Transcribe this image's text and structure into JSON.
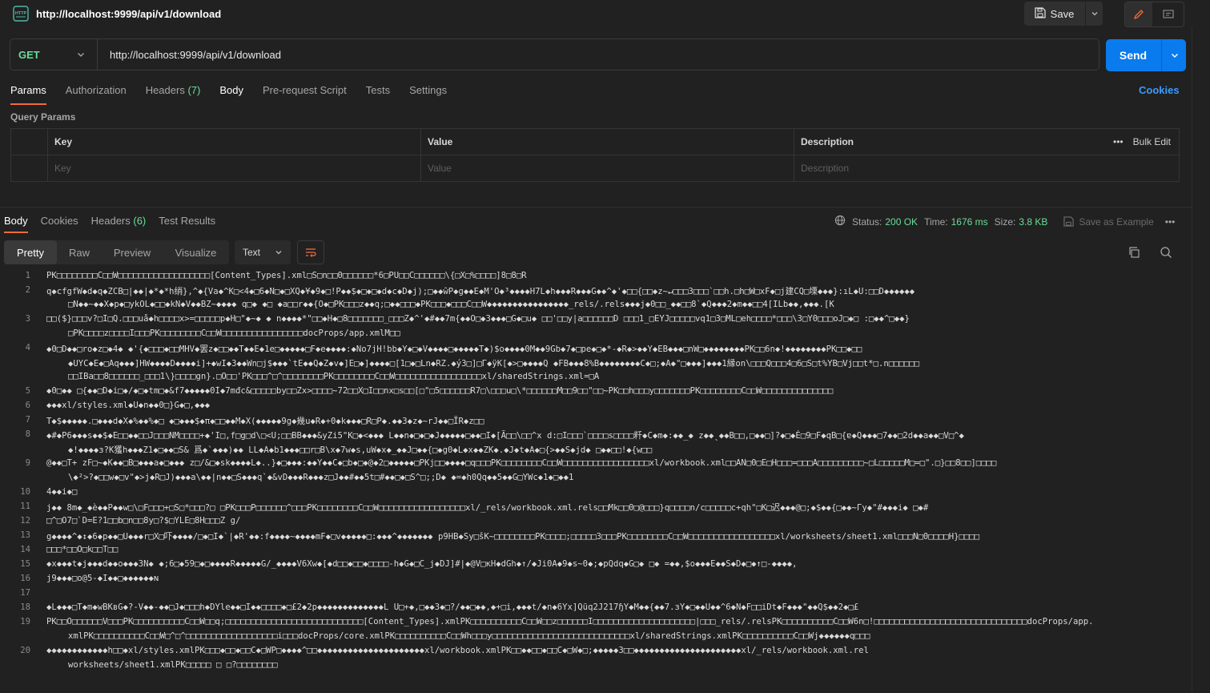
{
  "request": {
    "title": "http://localhost:9999/api/v1/download",
    "method": "GET",
    "url": "http://localhost:9999/api/v1/download",
    "save_label": "Save",
    "send_label": "Send"
  },
  "request_tabs": [
    {
      "label": "Params"
    },
    {
      "label": "Authorization"
    },
    {
      "label": "Headers",
      "count": "(7)"
    },
    {
      "label": "Body"
    },
    {
      "label": "Pre-request Script"
    },
    {
      "label": "Tests"
    },
    {
      "label": "Settings"
    }
  ],
  "cookies_label": "Cookies",
  "query_params": {
    "label": "Query Params",
    "headers": {
      "key": "Key",
      "value": "Value",
      "description": "Description",
      "bulk_edit": "Bulk Edit"
    },
    "placeholders": {
      "key": "Key",
      "value": "Value",
      "description": "Description"
    }
  },
  "response": {
    "tabs": [
      {
        "label": "Body"
      },
      {
        "label": "Cookies"
      },
      {
        "label": "Headers",
        "count": "(6)"
      },
      {
        "label": "Test Results"
      }
    ],
    "status_label": "Status:",
    "status_value": "200 OK",
    "time_label": "Time:",
    "time_value": "1676 ms",
    "size_label": "Size:",
    "size_value": "3.8 KB",
    "save_example": "Save as Example",
    "formats": [
      "Pretty",
      "Raw",
      "Preview",
      "Visualize"
    ],
    "text_format": "Text"
  },
  "colors": {
    "accent": "#f26b3a",
    "send": "#097bed",
    "link": "#3b9cff",
    "success": "#6bdd9a"
  },
  "icons": [
    "http-icon",
    "save-icon",
    "chevron-down-icon",
    "pencil-icon",
    "comment-icon",
    "globe-icon",
    "ellipsis-icon",
    "wrap-icon",
    "copy-icon",
    "search-icon"
  ],
  "code_lines": [
    {
      "n": "1",
      "parts": [
        "PK□□□□□□□□C□□W□□□□□□□□□□□□□□□□□□[Content_Types].xml□S□n□□0□□□□□□*6□PU□□C□□□□□□\\{□X□%□□□□]8□8□R"
      ]
    },
    {
      "n": "2",
      "parts": [
        "q◆cfgfW◆d◆q◆ZCB□|◆◆|◆*◆*h绡},^◆{Va◆^K□<4◆□6◆N□◆□XQ◆¥◆9◆□!P◆◆$◆□◆□◆d◆c◆D◆j);□◆◆ŵP◆g◆◆E◆M'O◆³◆◆◆◆H7L◆h◆◆◆R◆◆◆G◆◆^◆'◆□□{□□◆z~↵□□□3□□□`□□h.□h□W□xF◆□j建CQ□塛◆◆◆}:ıL◆U:□□D◆◆◆◆◆◆",
        "□N◆◆~◆◆X◆p◆□ykOL◆□□◆kN◆V◆◆BZ~◆◆◆◆ q□◆ ◆□ ◆a□□r◆◆{O◆□PK□□□z◆◆q;□◆◆□□□◆PK□□□◆□□□C□□W◆◆◆◆◆◆◆◆◆◆◆◆◆◆◆◆_rels/.rels◆◆◆j◆0□□_◆◆□□8`◆Q◆◆◆2◆m◆◆□□4[ILb◆◆,◆◆◆.[K"
      ]
    },
    {
      "n": "3",
      "parts": [
        "□□($}□□□v?□I□Q.□□□uå◆h□□□□x>=□□□□□p◆H□\"◆~◆ ◆ n◆◆◆◆*\"□□◆H◆□8□□□□□□□_□□□Z◆^'◆#◆◆7m{◆◆O□◆3◆◆◆□G◆□u◆ □□'□□y|a□□□□□□D  □□□1_□EYJ□□□□□vq1□3□ML□eh□□□□*□□□\\3□Y0□□□oJ□◆□ :□◆◆^□◆◆}",
        "□PK□□□□z□□□□I□□□PK□□□□□□□□C□□W□□□□□□□□□□□□□□□□docProps/app.xmlM□□"
      ]
    },
    {
      "n": "4",
      "parts": [
        "◆0□D◆◆□ro◆z□◆4◆ ◆'{◆□□□◆□□MHV◆罢z◆□□◆◆T◆◆E◆1e□◆◆◆◆◆□F◆e◆◆◆◆:◆No7jH!bb◆Y◆□◆V◆◆◆◆□◆◆◆◆◆T◆)$o◆◆◆◆0M◆◆9Gb◆7◆□pe◆□◆*-◆R◆>◆◆Y◆EB◆◆◆□nW□◆◆◆◆◆◆◆◆PK□□6n◆!◆◆◆◆◆◆◆◆PK□□◆□□",
        "◆UYC◆E◆□Aq◆◆◆]HW◆◆◆◆D◆◆◆◆i]+◆wI◆3◆◆Wn□j$◆◆◆`tE◆◆Q◆Z◆v◆]E□◆]◆◆◆◆□[1□◆□Ln◆RZ.◆ý3□]□Γ◆ÿK[◆>□◆◆◆◆Q  ◆FB◆◆◆8%B◆◆◆◆◆◆◆◆C◆□;◆A◆\"□◆◆◆]◆◆◆1縁on\\□□□Q□□□4□6□S□t%YB□Vj□□t*□.n□□□□□□",
        "□□IBa□□8□□□□□□_□□□1\\}□□□□gn}.□O□□'PK□□□^□^□□□□□□□□PK□□□□□□□□C□□W□□□□□□□□□□□□□□□□□xl/sharedStrings.xml=□A"
      ]
    },
    {
      "n": "5",
      "parts": [
        "◆0□◆◆ □{◆◆□D◆i□◆/◆□◆tm□◆&f7◆◆◆◆◆0Ì◆7mđc&□□□□□by□□Zx>□□□□~72□□X□I□□nx□s□□[□\"□5□□□□□□R7□\\□□□u□\\*□□□□□□M□□9□□\"□□~PK□□h□□□y□□□□□□□PK□□□□□□□□C□□W□□□□□□□□□□□□□□"
      ]
    },
    {
      "n": "6",
      "parts": [
        "◆◆◆xl/styles.xml◆U◆n◆◆0□}G◆□,◆◆◆"
      ]
    },
    {
      "n": "7",
      "parts": [
        "T◆$◆◆◆◆◆.□◆◆◆d◆X◆%◆◆%◆□ ◆□◆◆◆$◆π◆□□◆◆M◆X(◆◆◆◆◆9g◆幾u◆R◆+0◆k◆◆◆□R□P◆.◆◆3◆z◆~rJ◆◆□ÏR◆z□□"
      ]
    },
    {
      "n": "8",
      "parts": [
        "◆#◆P6◆◆◆s◆◆$◆E□□◆◆□□J□□□NM□□□□+◆'I□,f□g□d\\□<U;□□BB◆◆◆&yZi5\"K□◆<◆◆◆  L◆◆n◆□◆□◆J◆◆◆◆◆□◆◆□I◆[Ã□□\\□□^x d:□I□□□`□□□□s□□□□粁◆C◆m◆:◆◆_◆ z◆◆ˎ◆◆B□□,□◆◆□]?◆□◆Ė□9□F◆qB□{ɐ◆Q◆◆◆□7◆◆□2d◆◆a◆◆□V□^◆",
        "◆!◆◆◆◆з?K獲h◆◆◆Z1◆□◆◆□S& 爲◆`◆◆◆)◆◆ LL◆A◆b1◆◆◆□□r□B\\x◆7w◆s,uW◆x◆_◆◆J□◆◆{□◆g0◆L◆x◆◆ZK◆.◆J◆t◆A◆□{>◆◆S◆jd◆ □◆◆□□!◆{w□□"
      ]
    },
    {
      "n": "9",
      "parts": [
        "@◆◆□T+  zF□~◆K◆◆□B□◆◆◆a◆□◆◆◆ z□/&□◆sk◆◆◆◆L◆..}◆□◆◆◆:◆◆Y◆◆C◆□b◆□◆@◆2□◆◆◆◆◆□PKj□□◆◆◆◆□q□□□PK□□□□□□□□C□□W□□□□□□□□□□□□□□□□□xl/workbook.xml□□AN□0□E□H□□□=□□□A□□□□□□□□□~□L□□□□□M□=□\".□}□□8□□]□□□□",
        "\\◆²>?◆□□w◆□v\"◆>j◆R□J)◆◆◆a\\◆◆|n◆◆□S◆◆◆q`◆&vD◆◆◆R◆◆◆z□J◆◆#◆◆5t□#◆◆□◆□S^□;;D◆ ◆=◆h0Qq◆◆5◆◆G□YWc◆1◆□◆◆1"
      ]
    },
    {
      "n": "10",
      "parts": [
        "4◆◆i◆□"
      ]
    },
    {
      "n": "11",
      "parts": [
        "j◆◆ 8m◆_◆è◆◆P◆◆w□\\□F□□□+□S□*□□□?□ □PK□□□P□□□□□□^□□□PK□□□□□□□□C□□W□□□□□□□□□□□□□□□□□xl/_rels/workbook.xml.rels□□Mk□□0□@□□□}q□□□□n/c□□□□□c+qh\"□K□迟◆◆◆@□;◆$◆◆{□◆◆~Γy◆\"#◆◆◆i◆ □◆#"
      ]
    },
    {
      "n": "12",
      "parts": [
        "□^□O7□`D=E?1□□b□n□□8y□?$□YLE□8H□□□Z    g/"
      ]
    },
    {
      "n": "13",
      "parts": [
        "g◆◆◆◆^◆↕◆6◆p◆◆□U◆◆◆r□X□吓◆◆◆◆/□◆□I◆`|◆R'◆◆:f◆◆◆◆~◆◆◆◆mF◆□v◆◆◆◆◆□:◆◆◆^◆◆◆◆◆◆◆ p9HB◆Sy□šK~□□□□□□□□PK□□□□;□□□□□3□□□PK□□□□□□□□C□□W□□□□□□□□□□□□□□□□□xl/worksheets/sheet1.xml□□□N□0□□□□H}□□□□",
        "□□□*□□O□k□□T□□"
      ]
    },
    {
      "n": "15",
      "parts": [
        "◆x◆◆◆t◆j◆◆◆d◆◆o◆◆◆3N◆ ◆;6□◆59□◆□◆◆◆◆R◆◆◆◆◆G/_◆◆◆◆V6Xw◆[◆d□□◆□□◆□□□□-h◆G◆□C_j◆DJ]#|◆@V□κH◆dGh◆↑/◆Ji0A◆9◆s~0◆;◆pQdq◆G□◆ □◆ =◆◆,$o◆◆◆E◆◆S◆D◆□◆↑□-◆◆◆◆,"
      ]
    },
    {
      "n": "16",
      "parts": [
        "j9◆◆◆□o@5-◆I◆◆□◆◆◆◆◆◆ɴ"
      ]
    },
    {
      "n": "17",
      "parts": [
        ""
      ]
    },
    {
      "n": "18",
      "parts": [
        "◆L◆◆◆□T◆m◆wBKвG◆?-V◆◆-◆◆□J◆□□□h◆DYle◆◆□I◆◆□□□□◆□£2◆2p◆◆◆◆◆◆◆◆◆◆◆◆◆L U□+◆,□◆◆3◆□?/◆◆□◆◆,◆+□i,◆◆◆t/◆n◆6Yx]Qüq2J217ɧY◆M◆◆{◆◆7.зY◆□◆◆U◆◆^6◆N◆F□□iDt◆F◆◆◆\"◆◆Q$◆◆2◆□£"
      ]
    },
    {
      "n": "19",
      "parts": [
        "PK□□O□□□□□□V□□□PK□□□□□□□□□□C□□W□□q;□□□□□□□□□□□□□□□□□□□□□□□□□□□[Content_Types].xmlPK□□□□□□□□□□C□□W□□z□□□□□□I□□□□□□□□□□□□□□□□□□□□|□□□_rels/.relsPK□□□□□□□□□□C□□W6n□!□□□□□□□□□□□□□□□□□□□□□□□□□□□□□□docProps/app.",
        "xmlPK□□□□□□□□□□C□□W□^□^□□□□□□□□□□□□□□□□□□i□□□docProps/core.xmlPK□□□□□□□□□□C□□Wh□□□y□□□□□□□□□□□□□□□□□□□□□□□□□□□xl/sharedStrings.xmlPK□□□□□□□□□□C□□Wj◆◆◆◆◆◆q□□□"
      ]
    },
    {
      "n": "20",
      "parts": [
        "◆◆◆◆◆◆◆◆◆◆◆◆h□□◆xl/styles.xmlPK□□□◆□□◆□□C◆□WP□◆◆◆◆^□□◆◆◆◆◆◆◆◆◆◆◆◆◆◆◆◆◆◆◆◆◆xl/workbook.xmlPK□□◆◆□□◆□□C◆□W◆□;◆◆◆◆◆3□□◆◆◆◆◆◆◆◆◆◆◆◆◆◆◆◆◆◆◆◆◆xl/_rels/workbook.xml.rel",
        "worksheets/sheet1.xmlPK□□□□□  □  □?□□□□□□□□"
      ]
    }
  ]
}
